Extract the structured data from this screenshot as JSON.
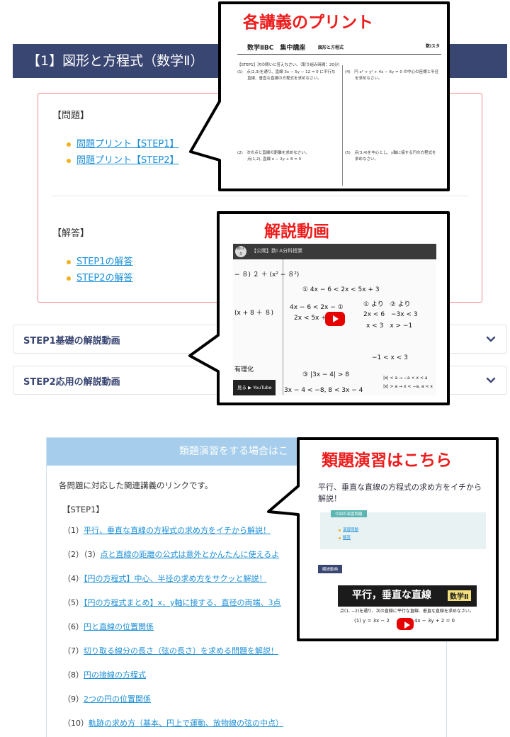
{
  "section": {
    "title": "【1】図形と方程式（数学Ⅱ）"
  },
  "problems": {
    "label": "【問題】",
    "links": [
      "問題プリント【STEP1】",
      "問題プリント【STEP2】"
    ]
  },
  "answers": {
    "label": "【解答】",
    "links": [
      "STEP1の解答",
      "STEP2の解答"
    ]
  },
  "accordions": [
    {
      "title": "STEP1基礎の解説動画"
    },
    {
      "title": "STEP2応用の解説動画"
    }
  ],
  "related": {
    "header": "類題演習をする場合はこ",
    "intro": "各問題に対応した関連講義のリンクです。",
    "step_label": "【STEP1】",
    "items": [
      {
        "num": "（1）",
        "pre": "",
        "text": "平行、垂直な直線の方程式の求め方をイチから解説！"
      },
      {
        "num": "（2）",
        "pre": "（3）",
        "text": "点と直線の距離の公式は意外とかんたんに使えるよ"
      },
      {
        "num": "（4）",
        "pre": "",
        "text": "【円の方程式】中心、半径の求め方をサクッと解説！"
      },
      {
        "num": "（5）",
        "pre": "",
        "text": "【円の方程式まとめ】x、y軸に接する、直径の両端、3点"
      },
      {
        "num": "（6）",
        "pre": "",
        "text": "円と直線の位置関係"
      },
      {
        "num": "（7）",
        "pre": "",
        "text": "切り取る線分の長さ（弦の長さ）を求める問題を解説！"
      },
      {
        "num": "（8）",
        "pre": "",
        "text": "円の接線の方程式"
      },
      {
        "num": "（9）",
        "pre": "",
        "text": "2つの円の位置関係"
      },
      {
        "num": "（10）",
        "pre": "",
        "text": "軌跡の求め方（基本、円上で運動、放物線の弦の中点）"
      }
    ]
  },
  "callouts": {
    "print": {
      "title": "各講義のプリント",
      "doc_title": "数学ⅡBC　集中講座",
      "doc_sub": "図形と方程式",
      "doc_logo": "数iスタ",
      "instruction": "【STEP1】次の問いに答えなさい。（取り組み時間：20分）",
      "q1": "(1)　点(2,3)を通り、直線 3x − 5y − 12 = 0 に平行な",
      "q1b": "直線、垂直な直線の方程式を求めなさい。",
      "q4": "(4)　円 x² + y² + 4x − 6y = 0 の中心の座標と半径",
      "q4b": "を求めなさい。",
      "q2": "(2)　次の点と直線の距離を求めなさい。",
      "q2b": "点(1,2), 直線 x − 2y + 8 = 0",
      "q5": "(5)　点(3,4)を中心とし、y軸に接する円の方程式を",
      "q5b": "求めなさい。"
    },
    "video": {
      "title": "解説動画",
      "top_text": "【公開】数Ⅰ A分科授業",
      "channel": "数iスタ",
      "eq1": "− ８) ２ ＋ (x² − ８²)",
      "eq2": "① 4x − 6 < 2x < 5x + 3",
      "eq3": "4x − 6 < 2x − ①",
      "eq4": "2x < 5x + 3",
      "eq5": "(x + 8 ＋ ８)",
      "eq6": "① より　② より",
      "eq7": "2x < 6　−3x < 3",
      "eq8": "x < 3　x > −1",
      "eq9": "−1 < x < 3",
      "eq10": "③ |3x − 4| > 8",
      "eq11": "3x − 4 < −8, 8 < 3x − 4",
      "eq12": "|x| < a → −a < x < a",
      "eq13": "|x| > a → x < −a, a < x",
      "eq14": "有理化",
      "watch": "見る ▶ YouTube"
    },
    "similar": {
      "title": "類題演習はこちら",
      "desc": "平行、垂直な直線の方程式の求め方をイチから解説！",
      "tag": "今回の演習問題",
      "links": [
        "演習問題",
        "解答"
      ],
      "tag2": "解説動画",
      "thumb_title": "平行，垂直な直線",
      "thumb_logo": "数学Ⅱ",
      "q1": "点(1, −2)を通り、次の直線に平行な直線、垂直な直線を求めなさい。",
      "q2": "(1)  y = 3x − 2　　　　　4x − 3y + 2 = 0"
    }
  },
  "colors": {
    "header_bg": "#3a4672",
    "link": "#1b8fd8",
    "callout_red": "#ee1c1c",
    "pink_border": "#f08a8a",
    "related_head": "#a6cdeb"
  }
}
